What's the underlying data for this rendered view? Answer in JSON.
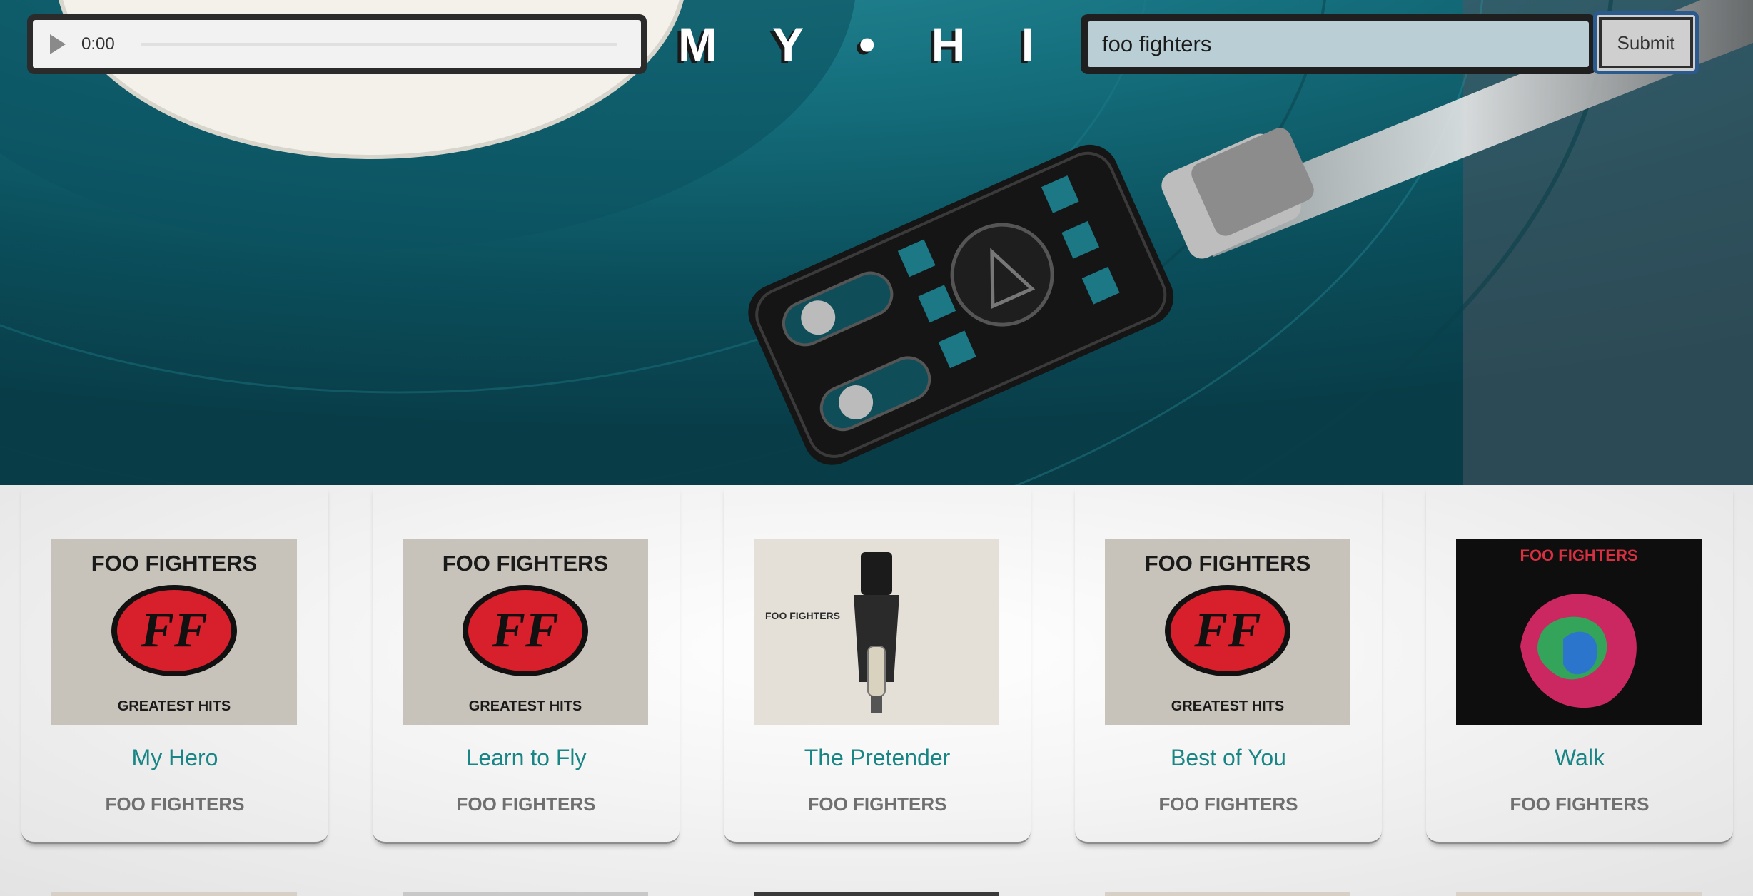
{
  "app": {
    "logo_text": "M Y • H I • F I"
  },
  "player": {
    "time": "0:00",
    "icon": "play-icon",
    "progress": 0
  },
  "search": {
    "value": "foo fighters",
    "submit_label": "Submit"
  },
  "results": [
    {
      "song": "My Hero",
      "artist": "FOO FIGHTERS",
      "cover_text_top": "FOO FIGHTERS",
      "cover_text_bottom": "GREATEST HITS",
      "cover_style": "greatest-hits"
    },
    {
      "song": "Learn to Fly",
      "artist": "FOO FIGHTERS",
      "cover_text_top": "FOO FIGHTERS",
      "cover_text_bottom": "GREATEST HITS",
      "cover_style": "greatest-hits"
    },
    {
      "song": "The Pretender",
      "artist": "FOO FIGHTERS",
      "cover_text_top": "FOO FIGHTERS",
      "cover_text_bottom": "",
      "cover_style": "bomb"
    },
    {
      "song": "Best of You",
      "artist": "FOO FIGHTERS",
      "cover_text_top": "FOO FIGHTERS",
      "cover_text_bottom": "GREATEST HITS",
      "cover_style": "greatest-hits"
    },
    {
      "song": "Walk",
      "artist": "FOO FIGHTERS",
      "cover_text_top": "FOO FIGHTERS",
      "cover_text_bottom": "",
      "cover_style": "wasting-light"
    }
  ],
  "colors": {
    "accent": "#1a8585",
    "hero": "#0f5866",
    "artist": "#6f6f6f"
  }
}
